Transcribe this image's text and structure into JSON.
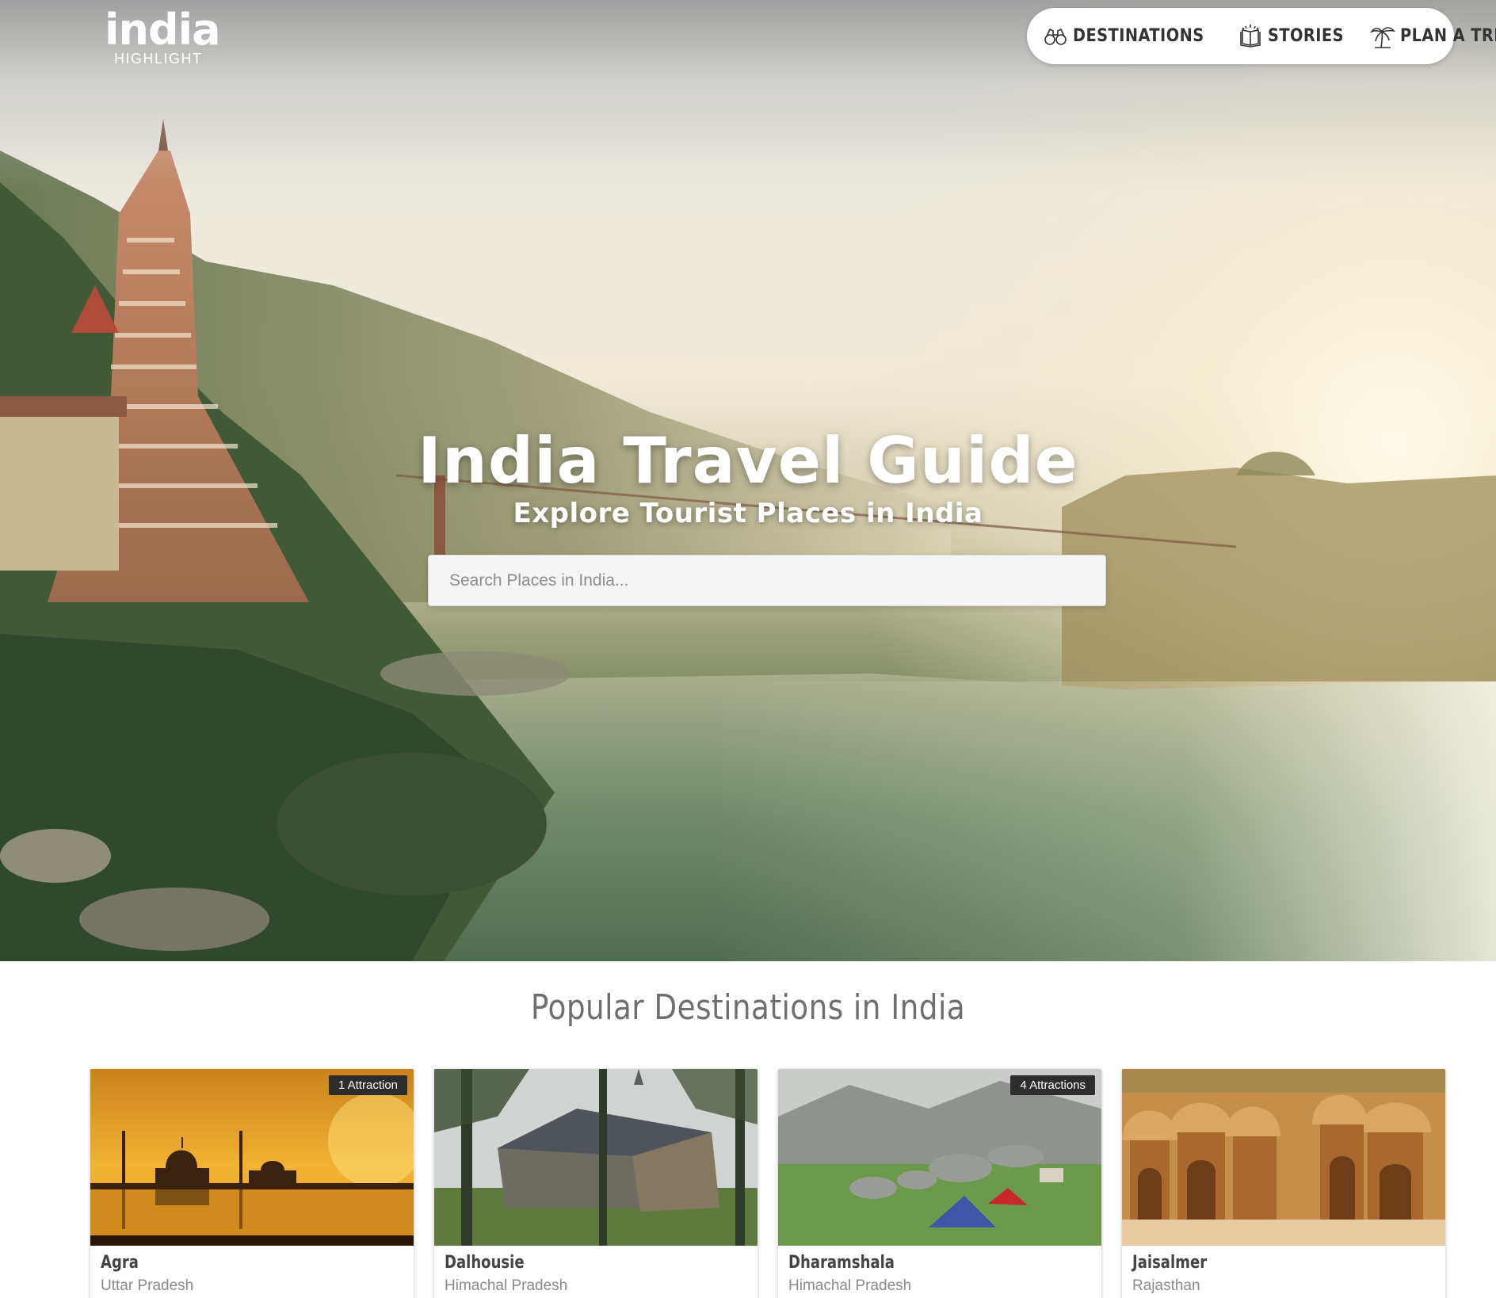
{
  "logo": {
    "word": "india",
    "sub": "HIGHLIGHT"
  },
  "nav": {
    "items": [
      {
        "label": "DESTINATIONS",
        "icon": "binoculars-icon"
      },
      {
        "label": "STORIES",
        "icon": "book-icon"
      },
      {
        "label": "PLAN A TRIP",
        "icon": "palm-tree-icon"
      }
    ]
  },
  "hero": {
    "title": "India Travel Guide",
    "subtitle": "Explore Tourist Places in India",
    "search_placeholder": "Search Places in India..."
  },
  "popular": {
    "title": "Popular Destinations in India",
    "cards": [
      {
        "name": "Agra",
        "state": "Uttar Pradesh",
        "badge": "1 Attraction"
      },
      {
        "name": "Dalhousie",
        "state": "Himachal Pradesh",
        "badge": ""
      },
      {
        "name": "Dharamshala",
        "state": "Himachal Pradesh",
        "badge": "4 Attractions"
      },
      {
        "name": "Jaisalmer",
        "state": "Rajasthan",
        "badge": ""
      }
    ]
  },
  "colors": {
    "nav_text": "#333333",
    "section_title": "#6f6f6f",
    "badge_bg": "#2d2d2d",
    "card_name": "#444444",
    "card_state": "#8a8a8a"
  }
}
